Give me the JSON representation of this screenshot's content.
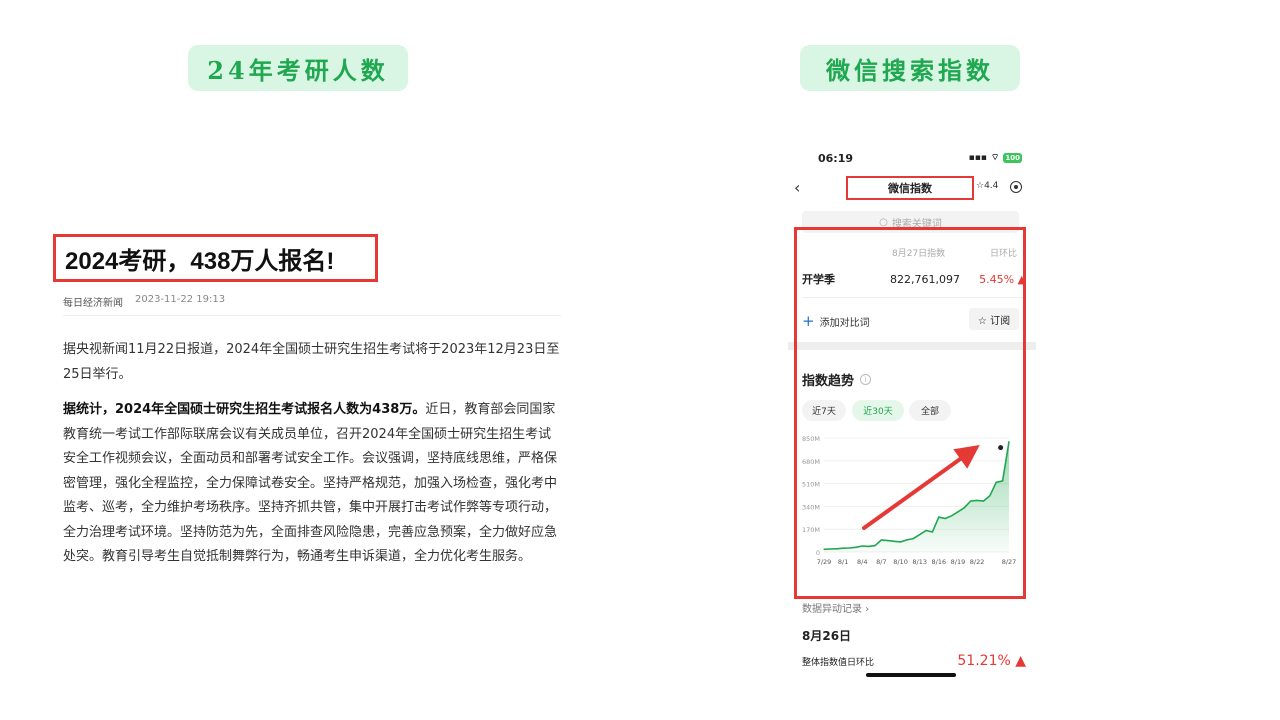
{
  "pills": {
    "left": "24年考研人数",
    "right": "微信搜索指数"
  },
  "article": {
    "title": "2024考研，438万人报名!",
    "source": "每日经济新闻",
    "time": "2023-11-22 19:13",
    "para1": "据央视新闻11月22日报道，2024年全国硕士研究生招生考试将于2023年12月23日至25日举行。",
    "para2_bold": "据统计，2024年全国硕士研究生招生考试报名人数为438万。",
    "para2_rest": "近日，教育部会同国家教育统一考试工作部际联席会议有关成员单位，召开2024年全国硕士研究生招生考试安全工作视频会议，全面动员和部署考试安全工作。会议强调，坚持底线思维，严格保密管理，强化全程监控，全力保障试卷安全。坚持严格规范，加强入场检查，强化考中监考、巡考，全力维护考场秩序。坚持齐抓共管，集中开展打击考试作弊等专项行动，全力治理考试环境。坚持防范为先，全面排查风险隐患，完善应急预案，全力做好应急处突。教育引导考生自觉抵制舞弊行为，畅通考生申诉渠道，全力优化考生服务。"
  },
  "phone": {
    "time": "06:19",
    "battery": "100",
    "nav_title": "微信指数",
    "star_rating": "☆4.4",
    "search_placeholder": "搜索关键词",
    "col_index": "8月27日指数",
    "col_change": "日环比",
    "keyword": "开学季",
    "keyword_value": "822,761,097",
    "keyword_change": "5.45% ▲",
    "add_compare": "添加对比词",
    "subscribe": "☆ 订阅",
    "trend_title": "指数趋势",
    "ranges": [
      "近7天",
      "近30天",
      "全部"
    ],
    "active_range": "近30天",
    "anomaly_link": "数据异动记录 ›",
    "anomaly_date": "8月26日",
    "overall_label": "整体指数值日环比",
    "overall_value": "51.21% ▲"
  },
  "colors": {
    "accent_green": "#1fa84f",
    "highlight_red": "#e53935",
    "up_red": "#e53935"
  },
  "chart_data": {
    "type": "area",
    "x": [
      "7/29",
      "7/30",
      "7/31",
      "8/1",
      "8/2",
      "8/3",
      "8/4",
      "8/5",
      "8/6",
      "8/7",
      "8/8",
      "8/9",
      "8/10",
      "8/11",
      "8/12",
      "8/13",
      "8/14",
      "8/15",
      "8/16",
      "8/17",
      "8/18",
      "8/19",
      "8/20",
      "8/21",
      "8/22",
      "8/23",
      "8/24",
      "8/25",
      "8/26",
      "8/27"
    ],
    "series": [
      {
        "values": [
          20,
          22,
          24,
          28,
          30,
          35,
          45,
          42,
          48,
          90,
          85,
          80,
          75,
          90,
          100,
          130,
          160,
          150,
          260,
          250,
          270,
          300,
          330,
          380,
          385,
          380,
          420,
          520,
          530,
          823
        ]
      }
    ],
    "x_ticks": [
      "7/29",
      "8/1",
      "8/4",
      "8/7",
      "8/10",
      "8/13",
      "8/16",
      "8/19",
      "8/22",
      "8/27"
    ],
    "y_ticks": [
      "0",
      "170M",
      "340M",
      "510M",
      "680M",
      "850M"
    ],
    "ylim": [
      0,
      850
    ],
    "y_unit": "M"
  }
}
